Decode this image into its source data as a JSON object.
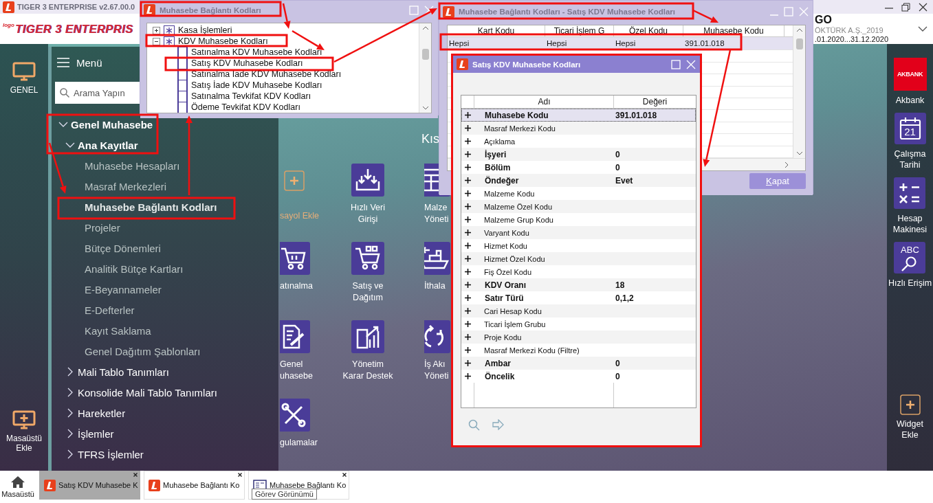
{
  "app": {
    "title": "TIGER 3 ENTERPRISE v2.67.00.0",
    "logo_mark": "logo",
    "logo": "TIGER 3 ENTERPRIS",
    "company_code": "GO",
    "company": "ÖKTÜRK A.Ş._2019",
    "period": ".01.2020...31.12.2020"
  },
  "left_rail": {
    "top": {
      "label": "GENEL"
    },
    "bottom": {
      "label": "Masaüstü\nEkle"
    }
  },
  "menu": {
    "title": "Menü",
    "search": {
      "placeholder": "Arama Yapın"
    },
    "tree": [
      {
        "label": "Genel Muhasebe",
        "expanded": true,
        "children": [
          {
            "label": "Ana Kayıtlar",
            "expanded": true,
            "children": [
              {
                "label": "Muhasebe Hesapları",
                "selected": false
              },
              {
                "label": "Masraf Merkezleri",
                "selected": false
              },
              {
                "label": "Muhasebe Bağlantı Kodları",
                "selected": true
              },
              {
                "label": "Projeler",
                "selected": false
              },
              {
                "label": "Bütçe Dönemleri",
                "selected": false
              },
              {
                "label": "Analitik Bütçe Kartları",
                "selected": false
              },
              {
                "label": "E-Beyannameler",
                "selected": false
              },
              {
                "label": "E-Defterler",
                "selected": false
              },
              {
                "label": "Kayıt Saklama",
                "selected": false
              },
              {
                "label": "Genel Dağıtım Şablonları",
                "selected": false
              }
            ]
          },
          {
            "label": "Mali Tablo Tanımları",
            "expanded": false
          },
          {
            "label": "Konsolide Mali Tablo Tanımları",
            "expanded": false
          },
          {
            "label": "Hareketler",
            "expanded": false
          },
          {
            "label": "İşlemler",
            "expanded": false
          },
          {
            "label": "TFRS İşlemler",
            "expanded": false
          }
        ]
      }
    ]
  },
  "desktop": {
    "title": "Kıs",
    "tiles": [
      {
        "label": "sayol Ekle",
        "kind": "add"
      },
      {
        "label": "Hızlı Veri\nGirişi",
        "kind": "import"
      },
      {
        "label": "Malze\nYöneti",
        "kind": "table"
      },
      {
        "label": "atınalma",
        "kind": "cart"
      },
      {
        "label": "Satış ve\nDağıtım",
        "kind": "cart-boxes"
      },
      {
        "label": "İthala",
        "kind": "ship"
      },
      {
        "label": "Genel\nuhasebe",
        "kind": "document"
      },
      {
        "label": "Yönetim\nKarar Destek",
        "kind": "chart"
      },
      {
        "label": "İş Akı\nYöneti",
        "kind": "cycle"
      },
      {
        "label": "gulamalar",
        "kind": "tools"
      }
    ]
  },
  "right_rail": {
    "items": [
      {
        "label": "Akbank",
        "kind": "bank",
        "badge": "AKBANK"
      },
      {
        "label": "Çalışma\nTarihi",
        "kind": "calendar",
        "badge": "21"
      },
      {
        "label": "Hesap\nMakinesi",
        "kind": "calculator"
      },
      {
        "label": "Hızlı Erişim",
        "kind": "abc",
        "badge": "ABC"
      }
    ],
    "widget": {
      "label": "Widget\nEkle"
    }
  },
  "tree_window": {
    "title": "Muhasebe Bağlantı Kodları",
    "tree": [
      {
        "label": "Kasa İşlemleri",
        "expanded": false
      },
      {
        "label": "KDV Muhasebe Kodları",
        "expanded": true,
        "children": [
          {
            "label": "Satınalma KDV Muhasebe Kodları"
          },
          {
            "label": "Satış KDV Muhasebe Kodları"
          },
          {
            "label": "Satınalma İade KDV Muhasebe Kodları"
          },
          {
            "label": "Satış İade KDV Muhasebe Kodları"
          },
          {
            "label": "Satınalma Tevkifat KDV Kodları"
          },
          {
            "label": "Ödeme Tevkifat KDV Kodları"
          }
        ]
      }
    ]
  },
  "list_window": {
    "title": "Muhasebe Bağlantı Kodları - Satış KDV Muhasebe Kodları",
    "columns": [
      "Kart Kodu",
      "Ticari İşlem G",
      "Özel Kodu",
      "Muhasebe Kodu"
    ],
    "rows": [
      {
        "cells": [
          "Hepsi",
          "Hepsi",
          "Hepsi",
          "391.01.018"
        ],
        "selected": true
      }
    ],
    "button": "Kapat"
  },
  "property_window": {
    "title": "Satış KDV Muhasebe Kodları",
    "columns": [
      "Adı",
      "Değeri"
    ],
    "rows": [
      {
        "name": "Muhasebe Kodu",
        "value": "391.01.018",
        "kind": "required",
        "selected": true
      },
      {
        "name": "Masraf Merkezi Kodu",
        "kind": "optional",
        "selected": false
      },
      {
        "name": "Açıklama",
        "kind": "optional",
        "selected": false
      },
      {
        "name": "İşyeri",
        "value": "0",
        "kind": "required",
        "selected": false
      },
      {
        "name": "Bölüm",
        "value": "0",
        "kind": "required",
        "selected": false
      },
      {
        "name": "Öndeğer",
        "value": "Evet",
        "kind": "required",
        "selected": false
      },
      {
        "name": "Malzeme Kodu",
        "kind": "optional",
        "selected": false
      },
      {
        "name": "Malzeme Özel Kodu",
        "kind": "optional",
        "selected": false
      },
      {
        "name": "Malzeme Grup Kodu",
        "kind": "optional",
        "selected": false
      },
      {
        "name": "Varyant Kodu",
        "kind": "optional",
        "selected": false
      },
      {
        "name": "Hizmet Kodu",
        "kind": "optional",
        "selected": false
      },
      {
        "name": "Hizmet Özel Kodu",
        "kind": "optional",
        "selected": false
      },
      {
        "name": "Fiş Özel Kodu",
        "kind": "optional",
        "selected": false
      },
      {
        "name": "KDV Oranı",
        "value": "18",
        "kind": "required",
        "selected": false
      },
      {
        "name": "Satır Türü",
        "value": "0,1,2",
        "kind": "required",
        "selected": false
      },
      {
        "name": "Cari Hesap Kodu",
        "kind": "optional",
        "selected": false
      },
      {
        "name": "Ticari İşlem Grubu",
        "kind": "optional",
        "selected": false
      },
      {
        "name": "Proje Kodu",
        "kind": "optional",
        "selected": false
      },
      {
        "name": "Masraf Merkezi Kodu (Filtre)",
        "kind": "optional",
        "selected": false
      },
      {
        "name": "Ambar",
        "value": "0",
        "kind": "required",
        "selected": false
      },
      {
        "name": "Öncelik",
        "value": "0",
        "kind": "required",
        "selected": false
      }
    ]
  },
  "taskbar": {
    "home": "Masaüstü",
    "tabs": [
      {
        "label": "Satış KDV Muhasebe K",
        "kind": "form",
        "selected": true
      },
      {
        "label": "Muhasebe Bağlantı Ko",
        "kind": "form",
        "selected": false
      },
      {
        "label": "Muhasebe Bağlantı Ko",
        "kind": "list",
        "selected": false
      }
    ],
    "tooltip": "Görev Görünümü"
  }
}
